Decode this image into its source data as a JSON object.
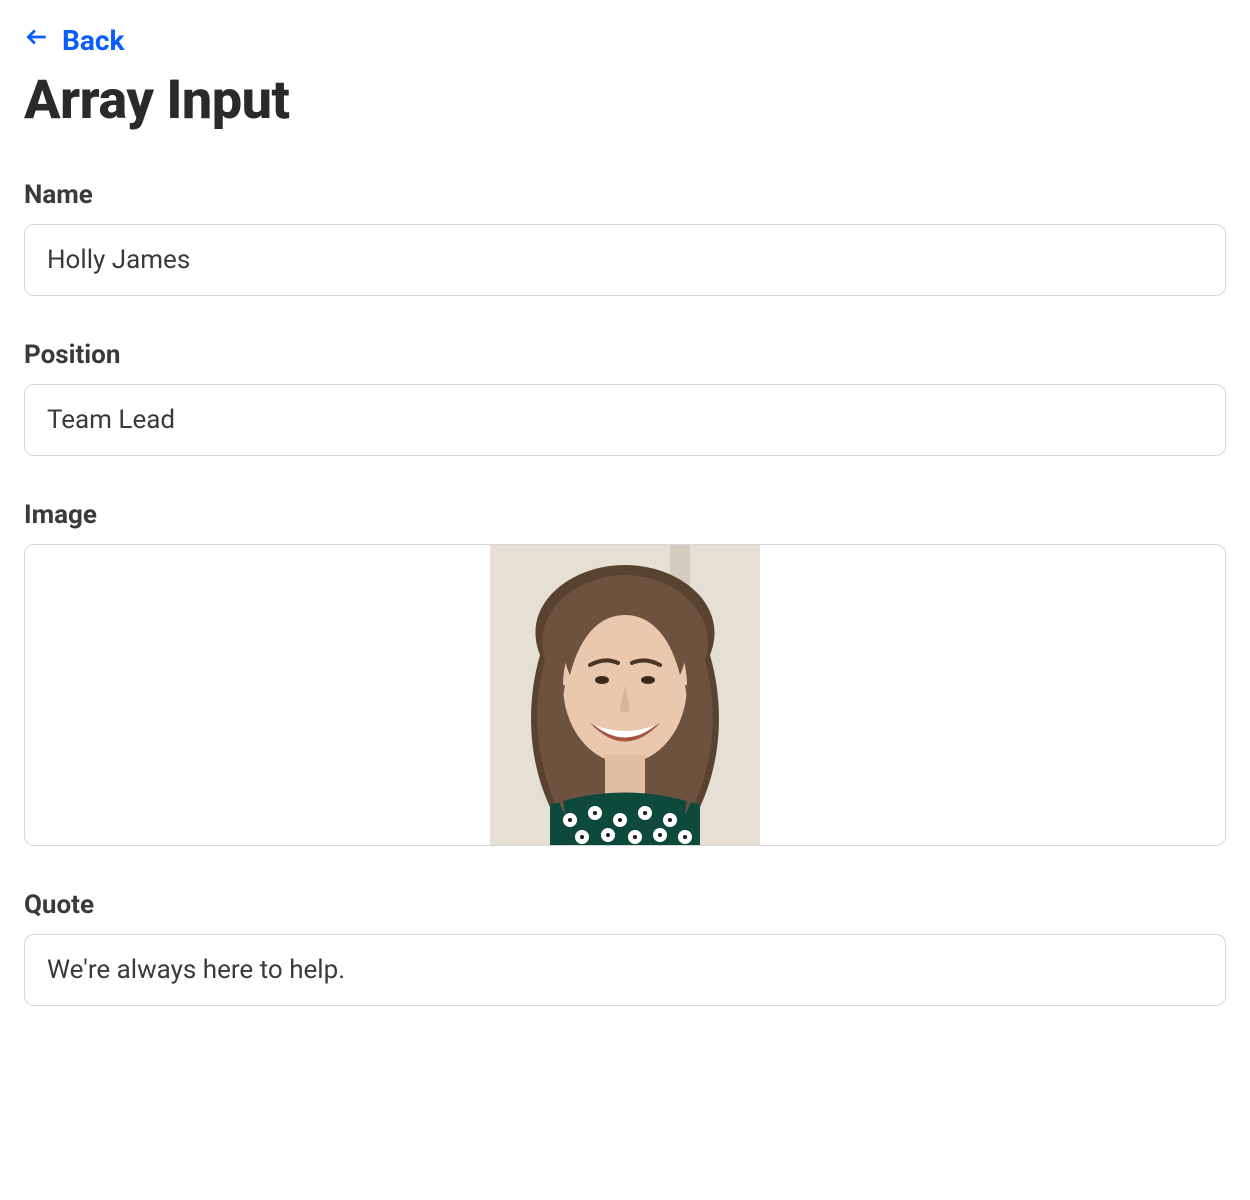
{
  "nav": {
    "back_label": "Back"
  },
  "page": {
    "title": "Array Input"
  },
  "fields": {
    "name": {
      "label": "Name",
      "value": "Holly James"
    },
    "position": {
      "label": "Position",
      "value": "Team Lead"
    },
    "image": {
      "label": "Image",
      "alt": "portrait"
    },
    "quote": {
      "label": "Quote",
      "value": "We're always here to help."
    }
  }
}
